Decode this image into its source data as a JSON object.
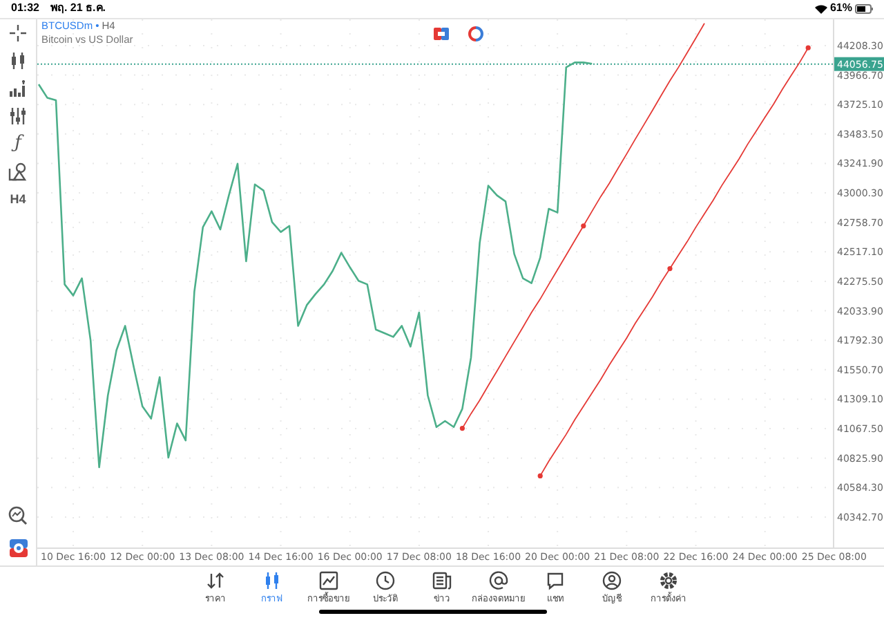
{
  "status_bar": {
    "time": "01:32",
    "date": "พฤ. 21 ธ.ค.",
    "battery": "61%"
  },
  "left_toolbar": {
    "items": [
      {
        "kind": "crosshair"
      },
      {
        "kind": "candles"
      },
      {
        "kind": "volumes"
      },
      {
        "kind": "indicators"
      },
      {
        "kind": "function",
        "label": "ƒ"
      },
      {
        "kind": "objects"
      },
      {
        "kind": "timeframe",
        "label": "H4"
      }
    ]
  },
  "chart_header": {
    "separator": "•",
    "timeframe": "H4",
    "description": "Bitcoin vs US Dollar"
  },
  "chart": {
    "chart_data": {
      "type": "line",
      "categories": [
        null,
        null,
        null,
        null,
        "10 Dec 16:00",
        null,
        null,
        null,
        null,
        null,
        null,
        null,
        "12 Dec 00:00",
        null,
        null,
        null,
        null,
        null,
        null,
        null,
        "13 Dec 08:00",
        null,
        null,
        null,
        null,
        null,
        null,
        null,
        "14 Dec 16:00",
        null,
        null,
        null,
        null,
        null,
        null,
        null,
        "16 Dec 00:00",
        null,
        null,
        null,
        null,
        null,
        null,
        null,
        "17 Dec 08:00",
        null,
        null,
        null,
        null,
        null,
        null,
        null,
        "18 Dec 16:00",
        null,
        null,
        null,
        null,
        null,
        null,
        null,
        "20 Dec 00:00",
        null,
        null,
        null,
        null,
        null,
        null,
        null,
        "21 Dec 08:00",
        null,
        null,
        null,
        null,
        null,
        null,
        null,
        "22 Dec 16:00",
        null,
        null,
        null,
        null,
        null,
        null,
        null,
        "24 Dec 00:00",
        null,
        null,
        null,
        null,
        null,
        null,
        null,
        "25 Dec 08:00"
      ],
      "series": [
        {
          "name": "BTCUSDm",
          "color": "#4caf8a",
          "values": [
            43890,
            43780,
            43760,
            42250,
            42160,
            42300,
            41790,
            40750,
            41340,
            41710,
            41910,
            41570,
            41250,
            41150,
            41490,
            40830,
            41110,
            40970,
            42190,
            42720,
            42850,
            42700,
            42980,
            43240,
            42440,
            43070,
            43020,
            42760,
            42680,
            42730,
            41910,
            42080,
            42170,
            42250,
            42360,
            42510,
            42390,
            42280,
            42250,
            41880,
            41850,
            41820,
            41910,
            41740,
            42020,
            41340,
            41080,
            41130,
            41080,
            41230,
            41650,
            42590,
            43060,
            42980,
            42930,
            42500,
            42300,
            42260,
            42470,
            42870,
            42840,
            44030,
            44070,
            44070,
            44060,
            null,
            null,
            null,
            null,
            null,
            null,
            null,
            null,
            null,
            null,
            null,
            null,
            null,
            null,
            null,
            null,
            null,
            null,
            null,
            null,
            null,
            null,
            null,
            null,
            null,
            null,
            null,
            null
          ]
        },
        {
          "color": "#e53935",
          "values": [
            null,
            null,
            null,
            null,
            null,
            null,
            null,
            null,
            null,
            null,
            null,
            null,
            null,
            null,
            null,
            null,
            null,
            null,
            null,
            null,
            null,
            null,
            null,
            null,
            null,
            null,
            null,
            null,
            null,
            null,
            null,
            null,
            null,
            null,
            null,
            null,
            null,
            null,
            null,
            null,
            null,
            null,
            null,
            null,
            null,
            null,
            null,
            null,
            null,
            41070,
            41190,
            41300,
            41420,
            41540,
            41660,
            41780,
            41900,
            42020,
            42130,
            42250,
            42370,
            42490,
            42610,
            42730,
            42850,
            42970,
            43080,
            43200,
            43320,
            43440,
            43560,
            43680,
            43800,
            43920,
            44030,
            44150,
            44270,
            44390,
            null,
            null,
            null,
            null,
            null,
            null,
            null,
            null,
            null,
            null,
            null,
            null,
            null,
            null,
            null
          ]
        },
        {
          "color": "#e53935",
          "values": [
            null,
            null,
            null,
            null,
            null,
            null,
            null,
            null,
            null,
            null,
            null,
            null,
            null,
            null,
            null,
            null,
            null,
            null,
            null,
            null,
            null,
            null,
            null,
            null,
            null,
            null,
            null,
            null,
            null,
            null,
            null,
            null,
            null,
            null,
            null,
            null,
            null,
            null,
            null,
            null,
            null,
            null,
            null,
            null,
            null,
            null,
            null,
            null,
            null,
            null,
            null,
            null,
            null,
            null,
            null,
            null,
            null,
            null,
            40680,
            40800,
            40910,
            41020,
            41140,
            41250,
            41360,
            41470,
            41590,
            41700,
            41810,
            41930,
            42040,
            42150,
            42270,
            42380,
            42490,
            42600,
            42720,
            42830,
            42940,
            43060,
            43170,
            43280,
            43400,
            43510,
            43620,
            43730,
            43850,
            43960,
            44070,
            44190,
            null,
            null,
            null
          ]
        }
      ],
      "ylim": [
        40093,
        44412
      ],
      "yticks": [
        {
          "value": 44208.3,
          "label": "44208.30"
        },
        {
          "value": 43966.7,
          "label": "43966.70"
        },
        {
          "value": 43725.1,
          "label": "43725.10"
        },
        {
          "value": 43483.5,
          "label": "43483.50"
        },
        {
          "value": 43241.9,
          "label": "43241.90"
        },
        {
          "value": 43000.3,
          "label": "43000.30"
        },
        {
          "value": 42758.7,
          "label": "42758.70"
        },
        {
          "value": 42517.1,
          "label": "42517.10"
        },
        {
          "value": 42275.5,
          "label": "42275.50"
        },
        {
          "value": 42033.9,
          "label": "42033.90"
        },
        {
          "value": 41792.3,
          "label": "41792.30"
        },
        {
          "value": 41550.7,
          "label": "41550.70"
        },
        {
          "value": 41309.1,
          "label": "41309.10"
        },
        {
          "value": 41067.5,
          "label": "41067.50"
        },
        {
          "value": 40825.9,
          "label": "40825.90"
        },
        {
          "value": 40584.3,
          "label": "40584.30"
        },
        {
          "value": 40342.7,
          "label": "40342.70"
        }
      ],
      "grid": true,
      "ref_lines": [
        {
          "axis": "y",
          "value": 44056.75,
          "label": "44056.75"
        }
      ]
    }
  },
  "tabs": [
    {
      "kind": "quotes",
      "label": "ราคา",
      "selected": false
    },
    {
      "kind": "chart",
      "label": "กราฟ",
      "selected": true
    },
    {
      "kind": "trade",
      "label": "การซื้อขาย",
      "selected": false
    },
    {
      "kind": "history",
      "label": "ประวัติ",
      "selected": false
    },
    {
      "kind": "news",
      "label": "ข่าว",
      "selected": false
    },
    {
      "kind": "mail",
      "label": "กล่องจดหมาย",
      "selected": false
    },
    {
      "kind": "chat",
      "label": "แชท",
      "selected": false
    },
    {
      "kind": "account",
      "label": "บัญชี",
      "selected": false
    },
    {
      "kind": "settings",
      "label": "การตั้งค่า",
      "selected": false
    }
  ]
}
